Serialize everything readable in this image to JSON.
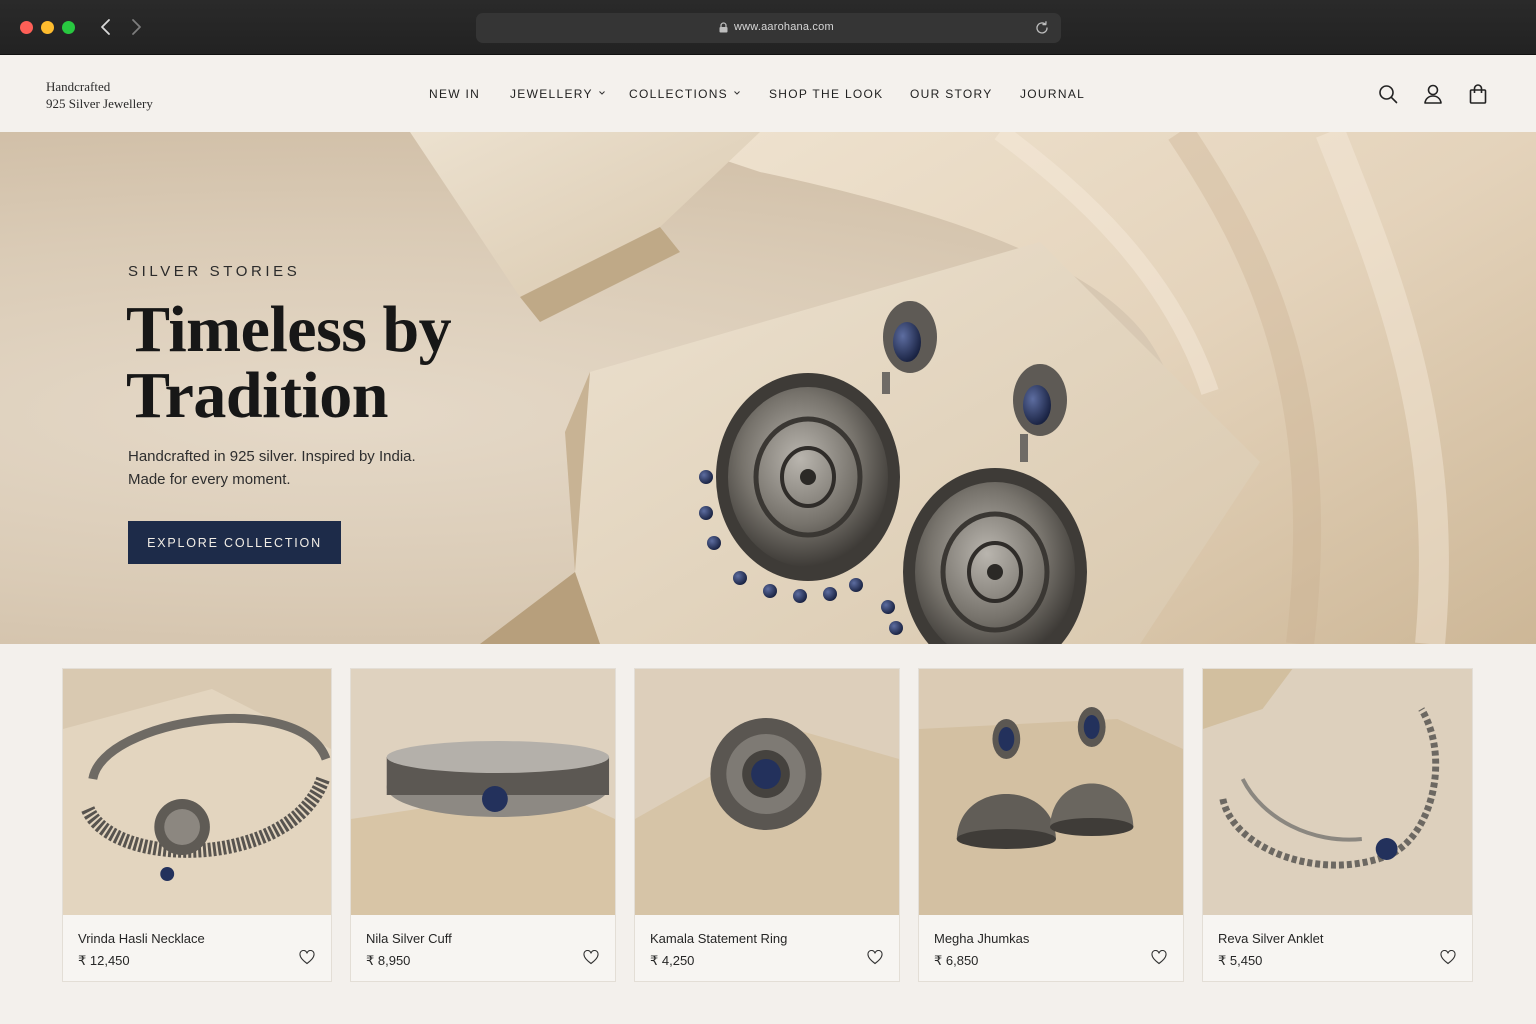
{
  "browser": {
    "url": "www.aarohana.com",
    "icons": [
      "back-arrow-icon",
      "forward-arrow-icon",
      "lock-icon",
      "reload-icon"
    ]
  },
  "header": {
    "brand_line1": "Handcrafted",
    "brand_line2": "925 Silver Jewellery",
    "nav": [
      {
        "label": "NEW IN",
        "dropdown": false
      },
      {
        "label": "JEWELLERY",
        "dropdown": true
      },
      {
        "label": "COLLECTIONS",
        "dropdown": true
      },
      {
        "label": "SHOP THE LOOK",
        "dropdown": false
      },
      {
        "label": "OUR STORY",
        "dropdown": false
      },
      {
        "label": "JOURNAL",
        "dropdown": false
      }
    ],
    "icons": [
      "search-icon",
      "account-icon",
      "shopping-bag-icon"
    ]
  },
  "hero": {
    "eyebrow": "SILVER STORIES",
    "title_line1": "Timeless by",
    "title_line2": "Tradition",
    "subtitle_line1": "Handcrafted in 925 silver. Inspired by India.",
    "subtitle_line2": "Made for every moment.",
    "cta_label": "EXPLORE COLLECTION"
  },
  "products": [
    {
      "name": "Vrinda Hasli Necklace",
      "price": "₹ 12,450"
    },
    {
      "name": "Nila Silver Cuff",
      "price": "₹ 8,950"
    },
    {
      "name": "Kamala Statement Ring",
      "price": "₹ 4,250"
    },
    {
      "name": "Megha Jhumkas",
      "price": "₹ 6,850"
    },
    {
      "name": "Reva Silver Anklet",
      "price": "₹ 5,450"
    }
  ],
  "colors": {
    "accent_navy": "#1d2b49",
    "page_background": "#f3f0ec",
    "stone_beige": "#dccdb8",
    "lapis_blue": "#23315c",
    "silver": "#8d8a85"
  }
}
